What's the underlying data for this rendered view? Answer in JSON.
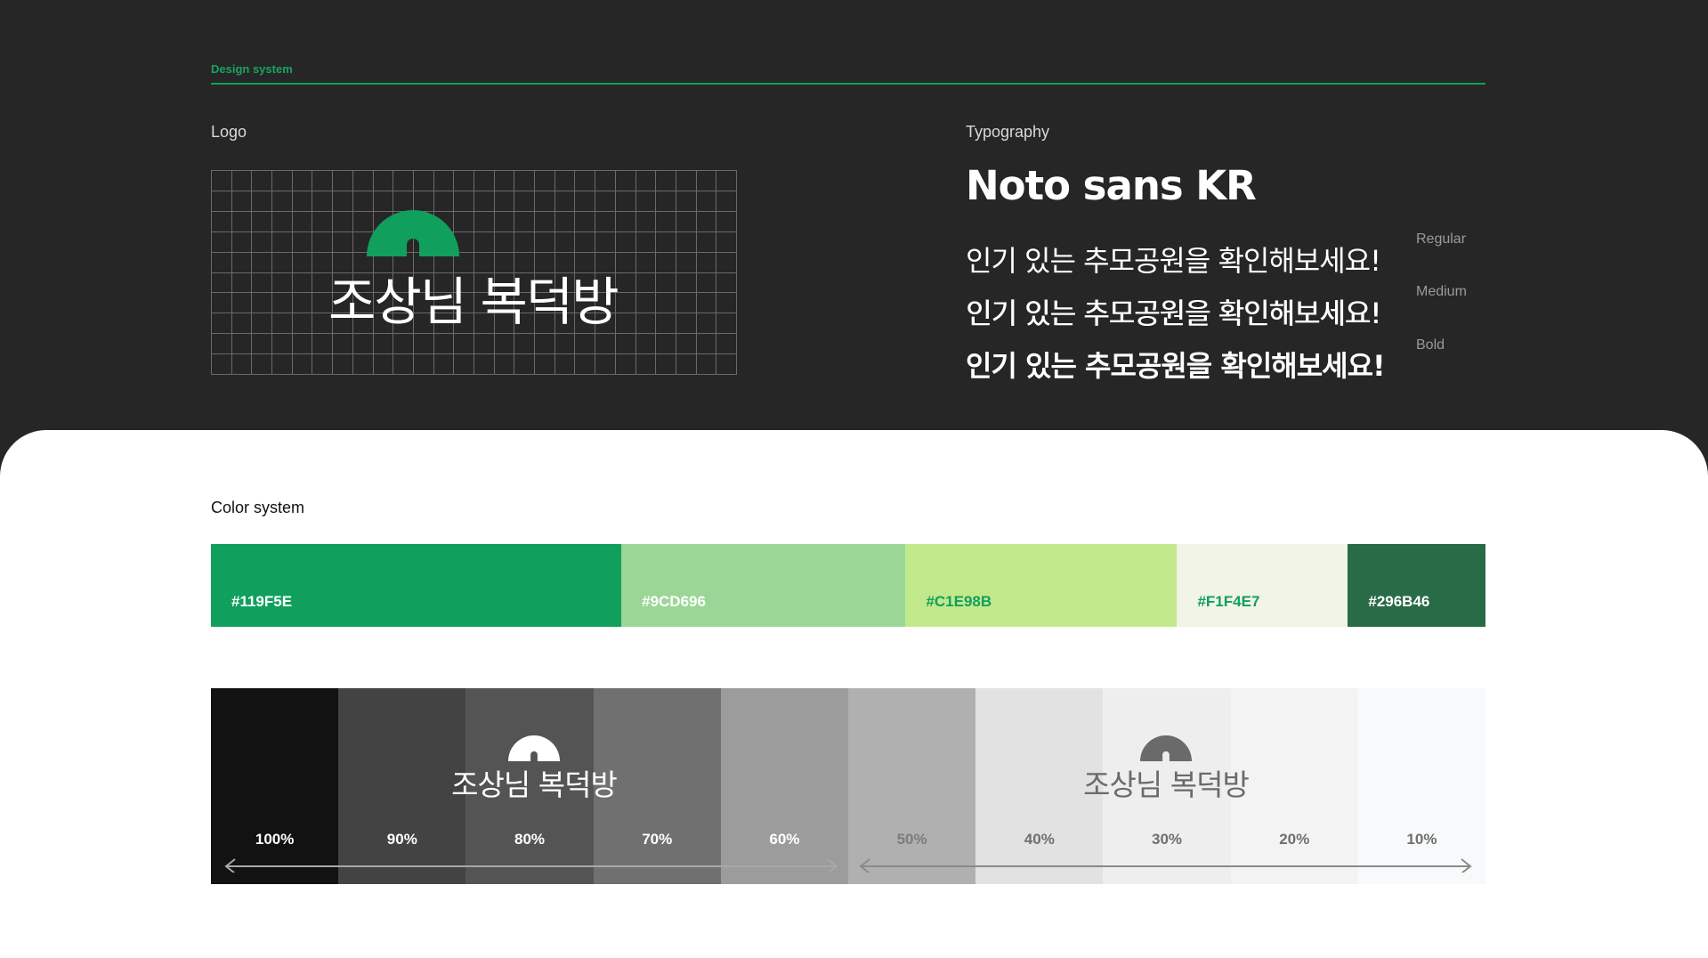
{
  "header": {
    "section_tag": "Design system"
  },
  "logo": {
    "label": "Logo",
    "wordmark": "조상님 복덕방",
    "accent_color": "#119F5E"
  },
  "typography": {
    "label": "Typography",
    "family": "Noto sans KR",
    "samples": [
      {
        "text": "인기 있는 추모공원을 확인해보세요!",
        "weight_label": "Regular"
      },
      {
        "text": "인기 있는 추모공원을 확인해보세요!",
        "weight_label": "Medium"
      },
      {
        "text": "인기 있는 추모공원을 확인해보세요!",
        "weight_label": "Bold"
      }
    ]
  },
  "color_system": {
    "label": "Color system",
    "swatches": [
      {
        "hex": "#119F5E",
        "text_color": "#ffffff",
        "share": 0.322
      },
      {
        "hex": "#9CD696",
        "text_color": "#ffffff",
        "share": 0.223
      },
      {
        "hex": "#C1E98B",
        "text_color": "#119F5E",
        "share": 0.213
      },
      {
        "hex": "#F1F4E7",
        "text_color": "#119F5E",
        "share": 0.134
      },
      {
        "hex": "#296B46",
        "text_color": "#ffffff",
        "share": 0.108
      }
    ],
    "shades": [
      {
        "label": "100%",
        "color": "#121212",
        "text_color": "#ffffff"
      },
      {
        "label": "90%",
        "color": "#434343",
        "text_color": "#ffffff"
      },
      {
        "label": "80%",
        "color": "#545454",
        "text_color": "#ffffff"
      },
      {
        "label": "70%",
        "color": "#707070",
        "text_color": "#ffffff"
      },
      {
        "label": "60%",
        "color": "#9c9c9c",
        "text_color": "#ffffff"
      },
      {
        "label": "50%",
        "color": "#b0b0b0",
        "text_color": "#7c7c7c"
      },
      {
        "label": "40%",
        "color": "#e2e2e2",
        "text_color": "#6f6f6f"
      },
      {
        "label": "30%",
        "color": "#eeeeee",
        "text_color": "#6f6f6f"
      },
      {
        "label": "20%",
        "color": "#f3f3f4",
        "text_color": "#6f6f6f"
      },
      {
        "label": "10%",
        "color": "#f8f9fa",
        "text_color": "#6f6f6f"
      }
    ],
    "mini_logo_light": {
      "wordmark": "조상님 복덕방",
      "color": "#ffffff"
    },
    "mini_logo_dark": {
      "wordmark": "조상님 복덕방",
      "color": "#6a6a6a"
    }
  }
}
